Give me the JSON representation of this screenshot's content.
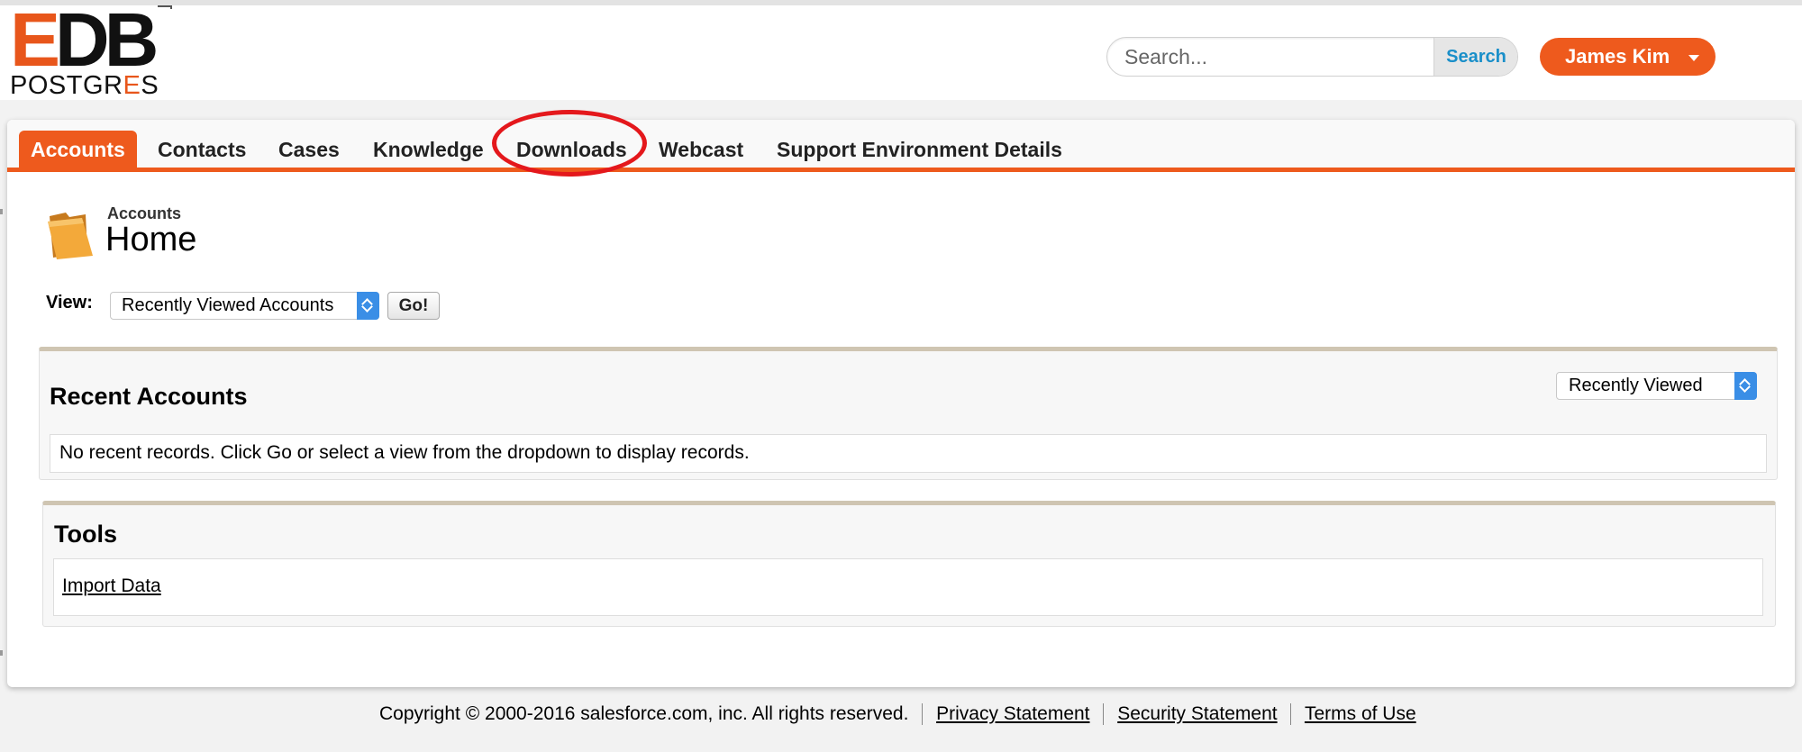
{
  "logo": {
    "brand_main": "EDB",
    "brand_sub_a": "POSTGR",
    "brand_sub_b": "E",
    "brand_sub_c": "S"
  },
  "header": {
    "search_placeholder": "Search...",
    "search_button": "Search",
    "user_name": "James Kim"
  },
  "tabs": [
    {
      "label": "Accounts",
      "active": true
    },
    {
      "label": "Contacts"
    },
    {
      "label": "Cases"
    },
    {
      "label": "Knowledge"
    },
    {
      "label": "Downloads",
      "highlighted": true
    },
    {
      "label": "Webcast"
    },
    {
      "label": "Support Environment Details"
    }
  ],
  "page": {
    "subtitle": "Accounts",
    "title": "Home"
  },
  "view": {
    "label": "View:",
    "selected": "Recently Viewed Accounts",
    "go_button": "Go!"
  },
  "recent_accounts": {
    "title": "Recent Accounts",
    "filter_selected": "Recently Viewed",
    "empty_message": "No recent records. Click Go or select a view from the dropdown to display records."
  },
  "tools": {
    "title": "Tools",
    "link": "Import Data"
  },
  "footer": {
    "copyright": "Copyright © 2000-2016 salesforce.com, inc. All rights reserved.",
    "links": [
      "Privacy Statement",
      "Security Statement",
      "Terms of Use"
    ]
  },
  "colors": {
    "accent": "#ee5a1d",
    "link_blue": "#1a8fc9",
    "annotation_red": "#e4181c",
    "select_blue": "#3a8ee6"
  }
}
